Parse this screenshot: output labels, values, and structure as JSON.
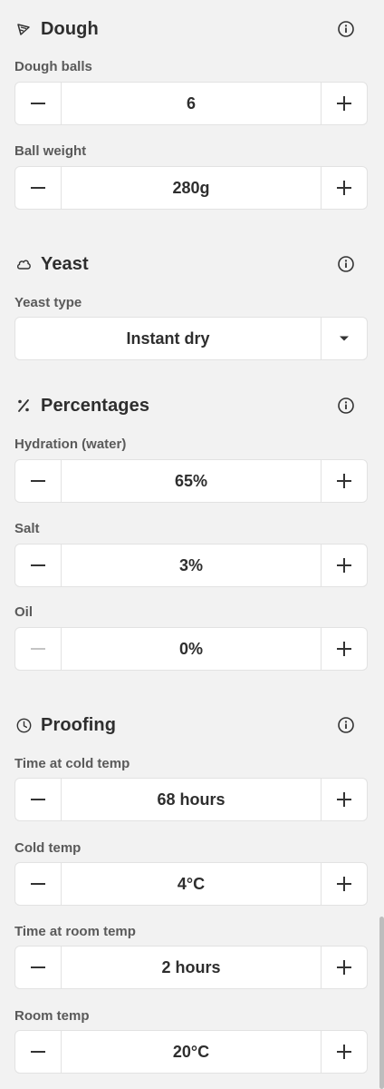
{
  "dough": {
    "title": "Dough",
    "icon": "pizza-slice-icon",
    "fields": [
      {
        "label": "Dough balls",
        "value": "6"
      },
      {
        "label": "Ball weight",
        "value": "280g"
      }
    ]
  },
  "yeast": {
    "title": "Yeast",
    "icon": "yeast-cloud-icon",
    "type_label": "Yeast type",
    "type_value": "Instant dry"
  },
  "percentages": {
    "title": "Percentages",
    "icon": "percent-icon",
    "fields": [
      {
        "label": "Hydration (water)",
        "value": "65%"
      },
      {
        "label": "Salt",
        "value": "3%"
      },
      {
        "label": "Oil",
        "value": "0%"
      }
    ]
  },
  "proofing": {
    "title": "Proofing",
    "icon": "clock-icon",
    "fields": [
      {
        "label": "Time at cold temp",
        "value": "68 hours"
      },
      {
        "label": "Cold temp",
        "value": "4°C"
      },
      {
        "label": "Time at room temp",
        "value": "2 hours"
      },
      {
        "label": "Room temp",
        "value": "20°C"
      }
    ]
  },
  "colors": {
    "background": "#f2f2f2",
    "card": "#ffffff",
    "text": "#2e2e2e",
    "label": "#5a5a5a",
    "disabled": "#c4c4c4"
  }
}
